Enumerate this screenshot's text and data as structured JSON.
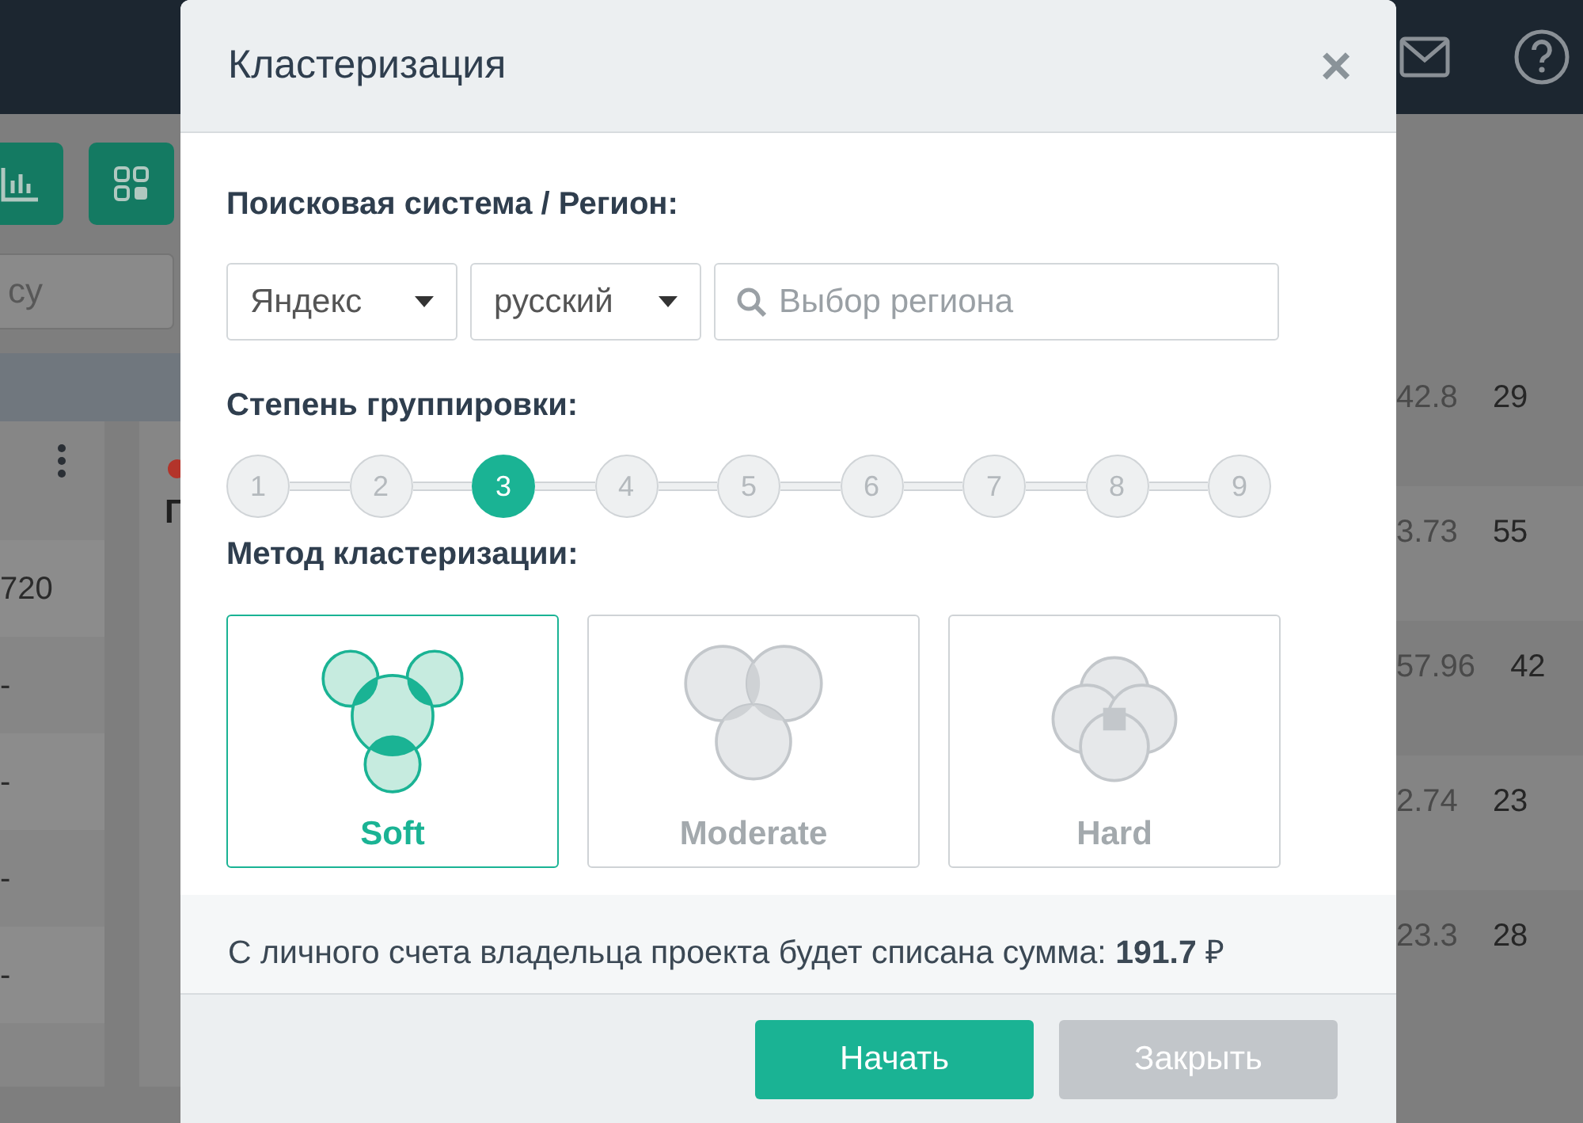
{
  "background": {
    "search": {
      "placeholder": "су"
    },
    "left_table": {
      "rows": [
        "720",
        "-",
        "-",
        "-",
        "-"
      ]
    },
    "panel_title": "Г",
    "right_table": {
      "rows": [
        [
          "42.8",
          "29"
        ],
        [
          "3.73",
          "55"
        ],
        [
          "57.96",
          "42"
        ],
        [
          "2.74",
          "23"
        ],
        [
          "23.3",
          "28"
        ]
      ]
    }
  },
  "dialog": {
    "title": "Кластеризация",
    "close": "×",
    "region_label": "Поисковая система / Регион:",
    "engine": {
      "value": "Яндекс"
    },
    "language": {
      "value": "русский"
    },
    "region": {
      "placeholder": "Выбор региона"
    },
    "grouping_label": "Степень группировки:",
    "levels": [
      {
        "label": "1",
        "selected": false
      },
      {
        "label": "2",
        "selected": false
      },
      {
        "label": "3",
        "selected": true
      },
      {
        "label": "4",
        "selected": false
      },
      {
        "label": "5",
        "selected": false
      },
      {
        "label": "6",
        "selected": false
      },
      {
        "label": "7",
        "selected": false
      },
      {
        "label": "8",
        "selected": false
      },
      {
        "label": "9",
        "selected": false
      }
    ],
    "method_label": "Метод кластеризации:",
    "methods": [
      {
        "label": "Soft",
        "kind": "soft",
        "selected": true
      },
      {
        "label": "Moderate",
        "kind": "moderate",
        "selected": false
      },
      {
        "label": "Hard",
        "kind": "hard",
        "selected": false
      }
    ],
    "cost_text": "С личного счета владельца проекта будет списана сумма: **191.7** ₽",
    "buttons": [
      {
        "label": "Начать",
        "kind": "primary"
      },
      {
        "label": "Закрыть",
        "kind": "secondary"
      }
    ]
  }
}
